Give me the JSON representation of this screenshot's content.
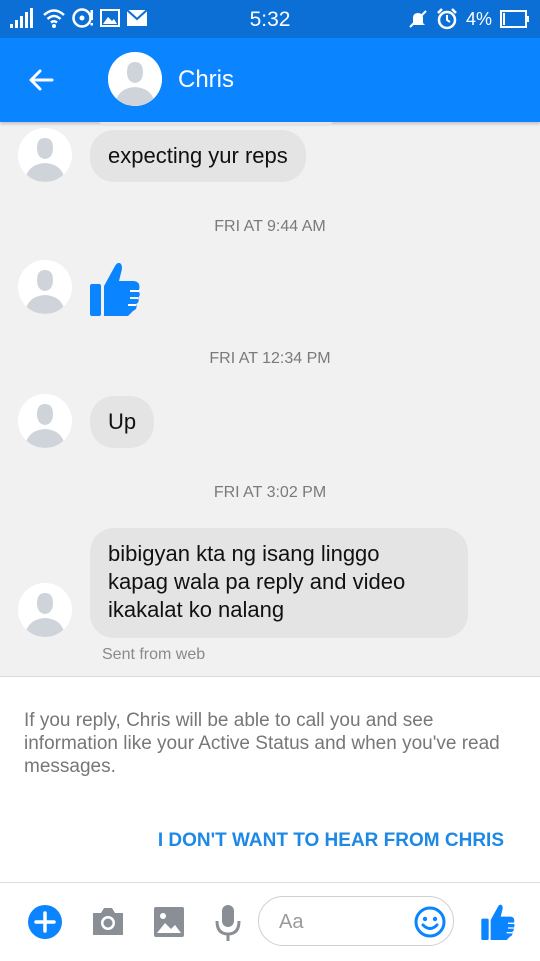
{
  "status_bar": {
    "time": "5:32",
    "battery": "4%"
  },
  "header": {
    "contact_name": "Chris"
  },
  "conversation": {
    "messages": [
      {
        "type": "text",
        "text": "expecting yur reps"
      },
      {
        "type": "timestamp",
        "text": "FRI AT 9:44 AM"
      },
      {
        "type": "like",
        "icon": "thumbs-up-icon"
      },
      {
        "type": "timestamp",
        "text": "FRI AT 12:34 PM"
      },
      {
        "type": "text",
        "text": "Up"
      },
      {
        "type": "timestamp",
        "text": "FRI AT 3:02 PM"
      },
      {
        "type": "text",
        "lines": [
          "bibigyan kta ng isang linggo",
          "kapag wala pa reply and video",
          "ikakalat ko nalang"
        ]
      }
    ],
    "sent_from": "Sent from web"
  },
  "notice": {
    "text": "If you reply, Chris will be able to call you and see information like your Active Status and when you've read messages.",
    "action": "I DON'T WANT TO HEAR FROM CHRIS"
  },
  "composer": {
    "placeholder": "Aa",
    "icons": [
      "plus-icon",
      "camera-icon",
      "image-icon",
      "microphone-icon",
      "emoji-icon",
      "thumbs-up-icon"
    ]
  },
  "colors": {
    "accent": "#0a84ff",
    "status_bar": "#0b6fd6",
    "bubble": "#e4e4e4",
    "link": "#1e88e5"
  }
}
